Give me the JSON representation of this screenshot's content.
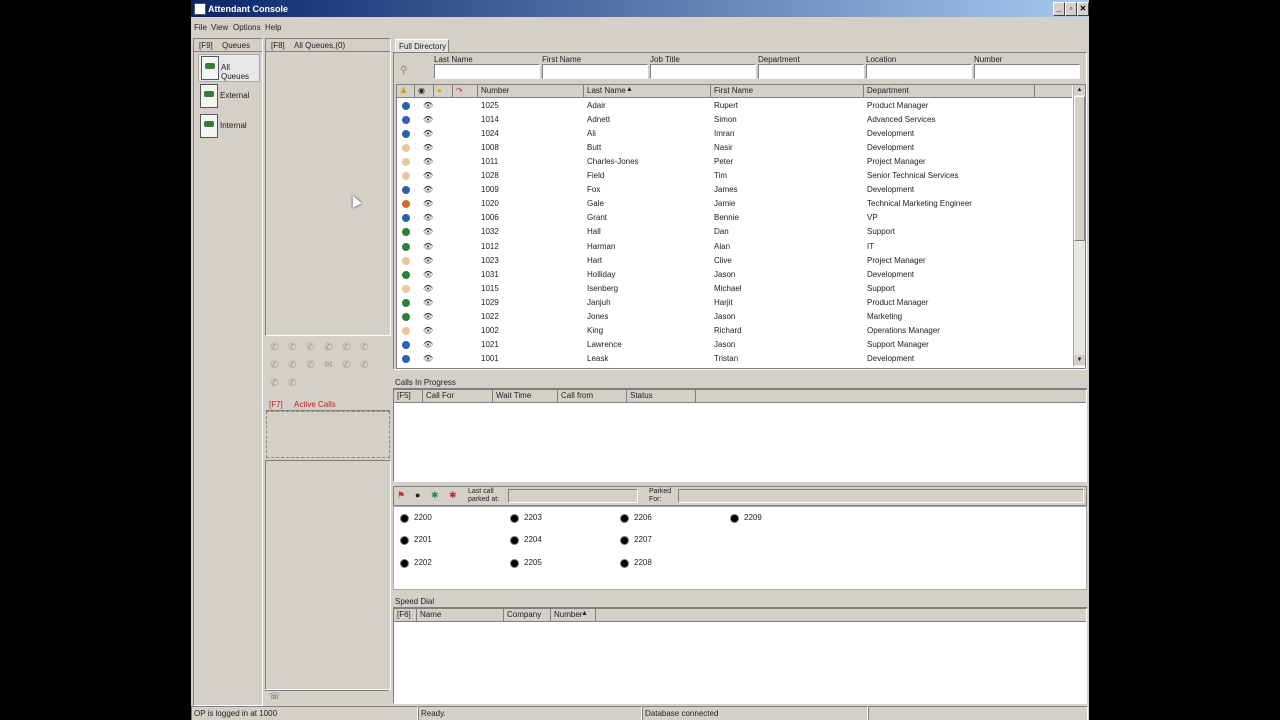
{
  "window": {
    "title": "Attendant Console",
    "minimize": "_",
    "maximize": "▫",
    "close": "✕"
  },
  "menu": [
    "File",
    "View",
    "Options",
    "Help"
  ],
  "left": {
    "f9": "[F9]",
    "queues_tab": "Queues",
    "queues": [
      {
        "label": "All Queues"
      },
      {
        "label": "External"
      },
      {
        "label": "Internal"
      }
    ]
  },
  "middle": {
    "f8": "[F8]",
    "all_queues": "All Queues,(0)",
    "f7": "[F7]",
    "active_calls": "Active Calls"
  },
  "directory": {
    "tab": "Full Directory",
    "search_labels": [
      "Last Name",
      "First Name",
      "Job Title",
      "Department",
      "Location",
      "Number"
    ],
    "columns": [
      "Number",
      "Last Name",
      "First Name",
      "Department"
    ],
    "rows": [
      {
        "status": "blue",
        "number": "1025",
        "last": "Adair",
        "first": "Rupert",
        "dept": "Product Manager"
      },
      {
        "status": "blue",
        "number": "1014",
        "last": "Adnett",
        "first": "Simon",
        "dept": "Advanced Services"
      },
      {
        "status": "blue",
        "number": "1024",
        "last": "Ali",
        "first": "Imran",
        "dept": "Development"
      },
      {
        "status": "tan",
        "number": "1008",
        "last": "Butt",
        "first": "Nasir",
        "dept": "Development"
      },
      {
        "status": "tan",
        "number": "1011",
        "last": "Charles-Jones",
        "first": "Peter",
        "dept": "Project Manager"
      },
      {
        "status": "tan",
        "number": "1028",
        "last": "Field",
        "first": "Tim",
        "dept": "Senior Technical Services"
      },
      {
        "status": "blue",
        "number": "1009",
        "last": "Fox",
        "first": "James",
        "dept": "Development"
      },
      {
        "status": "orange",
        "number": "1020",
        "last": "Gale",
        "first": "Jamie",
        "dept": "Technical Marketing Engineer"
      },
      {
        "status": "blue",
        "number": "1006",
        "last": "Grant",
        "first": "Bennie",
        "dept": "VP"
      },
      {
        "status": "green",
        "number": "1032",
        "last": "Hall",
        "first": "Dan",
        "dept": "Support"
      },
      {
        "status": "green",
        "number": "1012",
        "last": "Harman",
        "first": "Alan",
        "dept": "IT"
      },
      {
        "status": "tan",
        "number": "1023",
        "last": "Hart",
        "first": "Clive",
        "dept": "Project Manager"
      },
      {
        "status": "green",
        "number": "1031",
        "last": "Holliday",
        "first": "Jason",
        "dept": "Development"
      },
      {
        "status": "tan",
        "number": "1015",
        "last": "Isenberg",
        "first": "Michael",
        "dept": "Support"
      },
      {
        "status": "green",
        "number": "1029",
        "last": "Janjuh",
        "first": "Harjit",
        "dept": "Product Manager"
      },
      {
        "status": "green",
        "number": "1022",
        "last": "Jones",
        "first": "Jason",
        "dept": "Marketing"
      },
      {
        "status": "tan",
        "number": "1002",
        "last": "King",
        "first": "Richard",
        "dept": "Operations Manager"
      },
      {
        "status": "blue",
        "number": "1021",
        "last": "Lawrence",
        "first": "Jason",
        "dept": "Support Manager"
      },
      {
        "status": "blue",
        "number": "1001",
        "last": "Leask",
        "first": "Tristan",
        "dept": "Development"
      }
    ]
  },
  "status_colors": {
    "blue": "#3060b0",
    "tan": "#e8c8a0",
    "green": "#2e7d3a",
    "orange": "#d86a2a"
  },
  "calls": {
    "title": "Calls In Progress",
    "columns": [
      "[F5]",
      "Call For",
      "Wait Time",
      "Call from",
      "Status"
    ]
  },
  "parking": {
    "last_call_label": "Last call parked at:",
    "parked_for_label": "Parked For:",
    "slots": [
      "2200",
      "2201",
      "2202",
      "2203",
      "2204",
      "2205",
      "2206",
      "2207",
      "2208",
      "2209"
    ]
  },
  "speed_dial": {
    "title": "Speed Dial",
    "columns": [
      "[F6]",
      "Name",
      "Company",
      "Number"
    ]
  },
  "statusbar": {
    "login": "OP is logged in at 1000",
    "state": "Ready.",
    "db": "Database connected"
  }
}
